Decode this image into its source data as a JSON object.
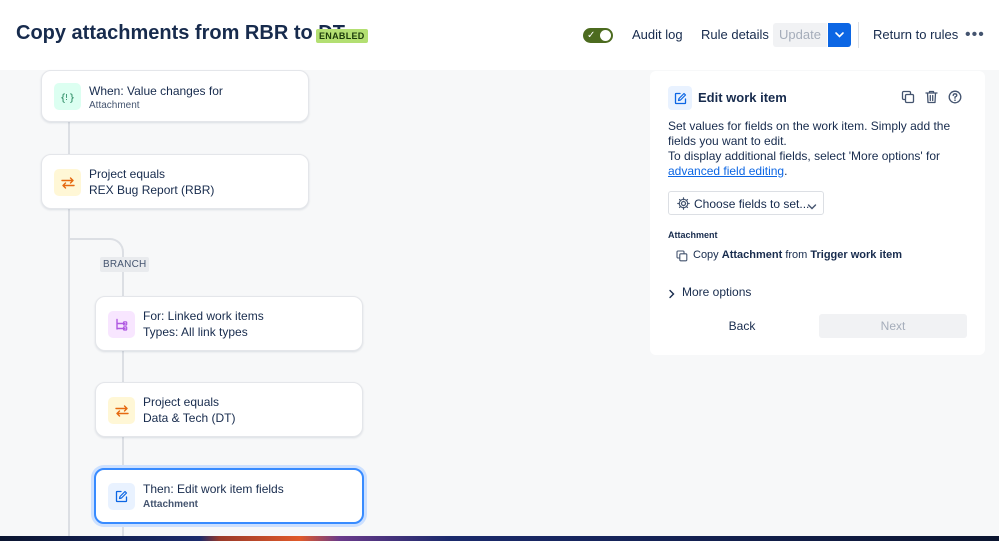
{
  "header": {
    "title": "Copy attachments from RBR to DT",
    "status_badge": "ENABLED",
    "toggle_on": true,
    "audit_log": "Audit log",
    "rule_details": "Rule details",
    "update": "Update",
    "return_to_rules": "Return to rules"
  },
  "flow": {
    "trigger": {
      "title": "When: Value changes for",
      "subtitle": "Attachment"
    },
    "condition1": {
      "title": "Project equals",
      "subtitle": "REX Bug Report (RBR)"
    },
    "branch_label": "BRANCH",
    "branch_for": {
      "title": "For: Linked work items",
      "subtitle": "Types: All link types"
    },
    "condition2": {
      "title": "Project equals",
      "subtitle": "Data & Tech (DT)"
    },
    "action": {
      "title": "Then: Edit work item fields",
      "subtitle": "Attachment"
    }
  },
  "panel": {
    "title": "Edit work item",
    "desc_part1": "Set values for fields on the work item. Simply add the fields you want to edit.",
    "desc_part2": "To display additional fields, select 'More options' for",
    "desc_link": "advanced field editing",
    "desc_end": ".",
    "choose_fields": "Choose fields to set...",
    "field_label": "Attachment",
    "copy_word": "Copy",
    "copy_field": "Attachment",
    "copy_from": "from",
    "copy_source": "Trigger work item",
    "more_options": "More options",
    "back": "Back",
    "next": "Next"
  },
  "colors": {
    "accent": "#0c66e4",
    "badge_bg": "#b3df72",
    "toggle_bg": "#4c6b1f",
    "trigger_icon_bg": "#dcfff1",
    "condition_icon_bg": "#fff7d6",
    "branch_icon_bg": "#f8e6ff",
    "action_icon_bg": "#e9f2ff"
  }
}
